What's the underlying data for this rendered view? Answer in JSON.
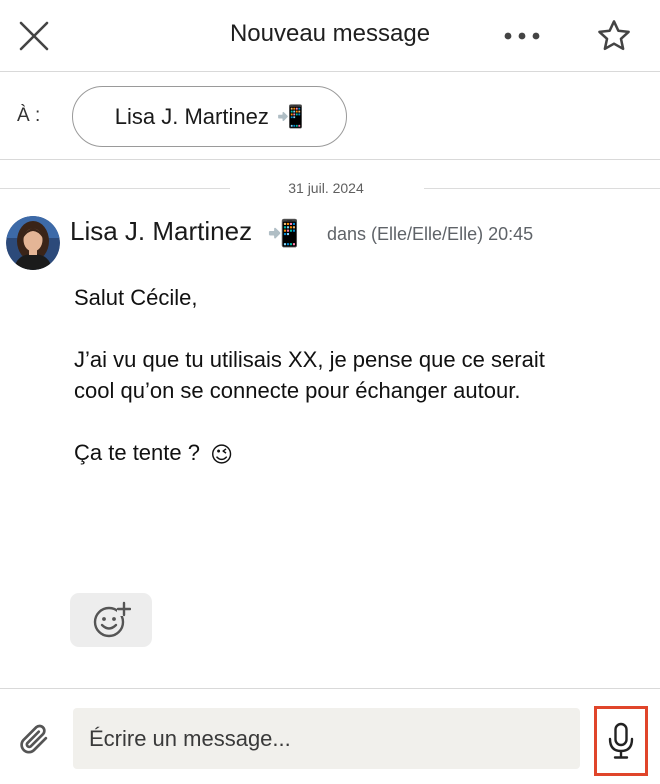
{
  "header": {
    "title": "Nouveau message",
    "close_icon": "close-icon",
    "more_icon": "more-horizontal-icon",
    "star_icon": "star-outline-icon"
  },
  "to_row": {
    "label": "À :",
    "recipient": "Lisa J. Martinez",
    "recipient_emoji": "📲"
  },
  "thread": {
    "date": "31 juil. 2024",
    "sender": {
      "name": "Lisa J. Martinez",
      "emoji": "📲",
      "meta": "dans (Elle/Elle/Elle) 20:45"
    },
    "message": {
      "greeting": "Salut Cécile,",
      "paragraph": "J’ai vu que tu utilisais XX, je pense que ce serait cool qu’on se connecte pour échanger autour.",
      "closing": "Ça te tente ?",
      "closing_emoji": "😉"
    },
    "reaction_icon": "add-reaction-icon"
  },
  "composer": {
    "attach_icon": "paperclip-icon",
    "placeholder": "Écrire un message...",
    "mic_icon": "microphone-icon",
    "highlight_color": "#e0452a"
  }
}
